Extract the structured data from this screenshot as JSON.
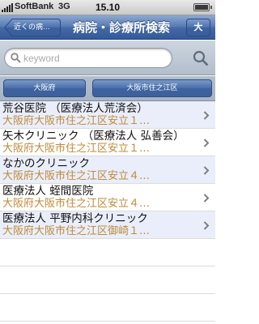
{
  "status_bar": {
    "carrier": "SoftBank",
    "network": "3G",
    "time": "15.10"
  },
  "nav": {
    "back_label": "近くの病...",
    "title": "病院・診療所検索",
    "right_label": "大"
  },
  "search": {
    "placeholder": "keyword",
    "value": ""
  },
  "scope": {
    "prefecture": "大阪府",
    "ward": "大阪市住之江区"
  },
  "results": [
    {
      "name": "荒谷医院 （医療法人荒済会）",
      "address": "大阪府大阪市住之江区安立１…"
    },
    {
      "name": "矢木クリニック （医療法人 弘善会）",
      "address": "大阪府大阪市住之江区安立１…"
    },
    {
      "name": "なかのクリニック",
      "address": "大阪府大阪市住之江区安立４…"
    },
    {
      "name": "医療法人 蛭間医院",
      "address": "大阪府大阪市住之江区安立４…"
    },
    {
      "name": "医療法人 平野内科クリニック",
      "address": "大阪府大阪市住之江区御崎１…"
    }
  ],
  "colors": {
    "nav_blue": "#456aa6",
    "address_text": "#bf8a3a",
    "alt_row": "#e9eefa"
  }
}
